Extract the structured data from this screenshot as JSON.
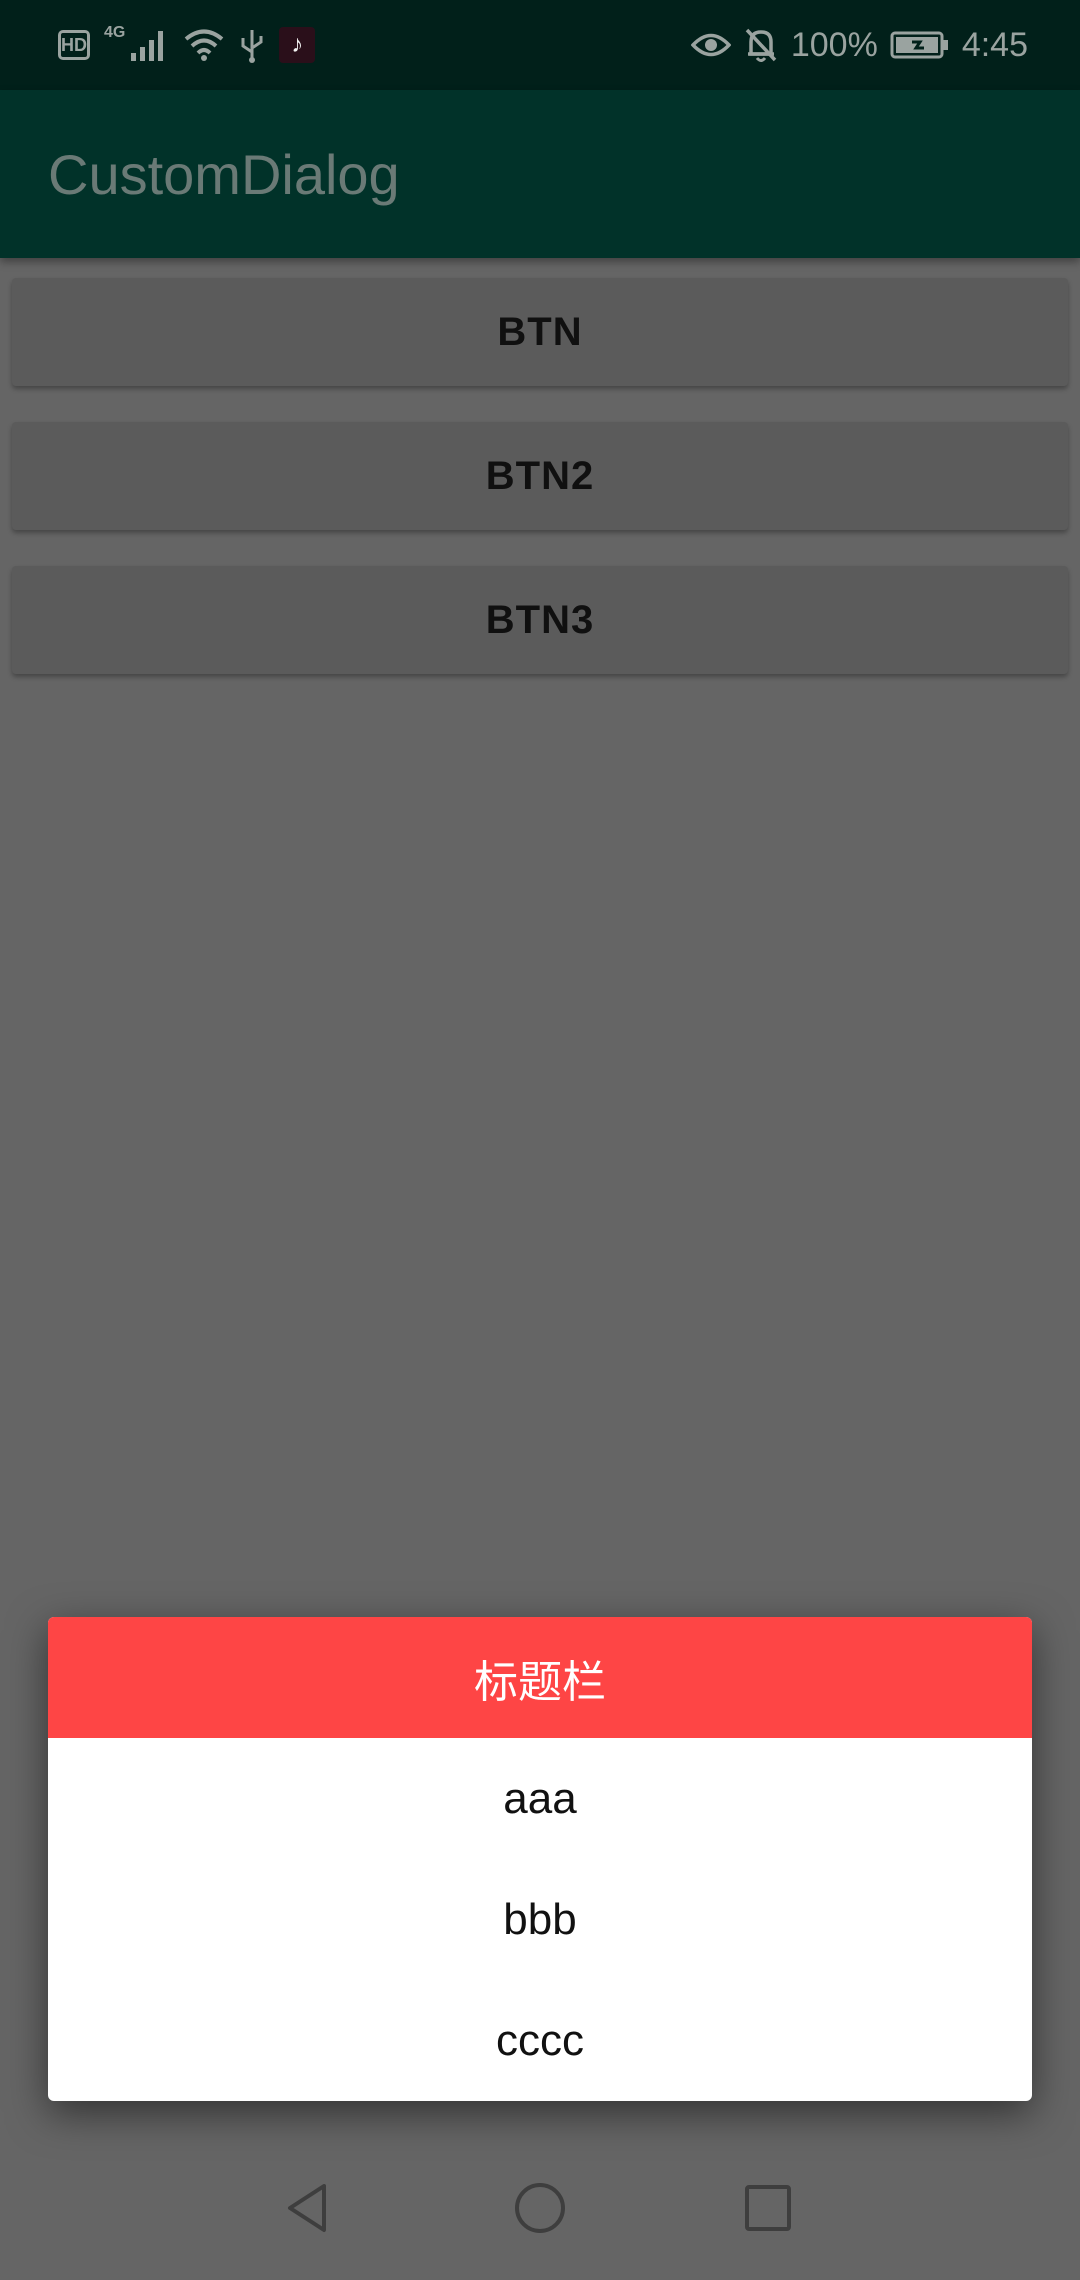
{
  "status_bar": {
    "hd_label": "HD",
    "network_label": "4G",
    "battery_text": "100%",
    "time": "4:45",
    "icons": [
      "signal-icon",
      "wifi-icon",
      "usb-icon",
      "tiktok-icon",
      "eye-icon",
      "bell-off-icon",
      "battery-icon"
    ]
  },
  "app_bar": {
    "title": "CustomDialog"
  },
  "buttons": [
    {
      "label": "BTN"
    },
    {
      "label": "BTN2"
    },
    {
      "label": "BTN3"
    }
  ],
  "dialog": {
    "title": "标题栏",
    "items": [
      {
        "label": "aaa"
      },
      {
        "label": "bbb"
      },
      {
        "label": "cccc"
      }
    ],
    "title_color": "#fe4545"
  },
  "nav_bar": {
    "icons": [
      "back-icon",
      "home-icon",
      "recents-icon"
    ]
  },
  "colors": {
    "status_bar": "#01201a",
    "app_bar": "#013229",
    "scrim": "#656565"
  }
}
